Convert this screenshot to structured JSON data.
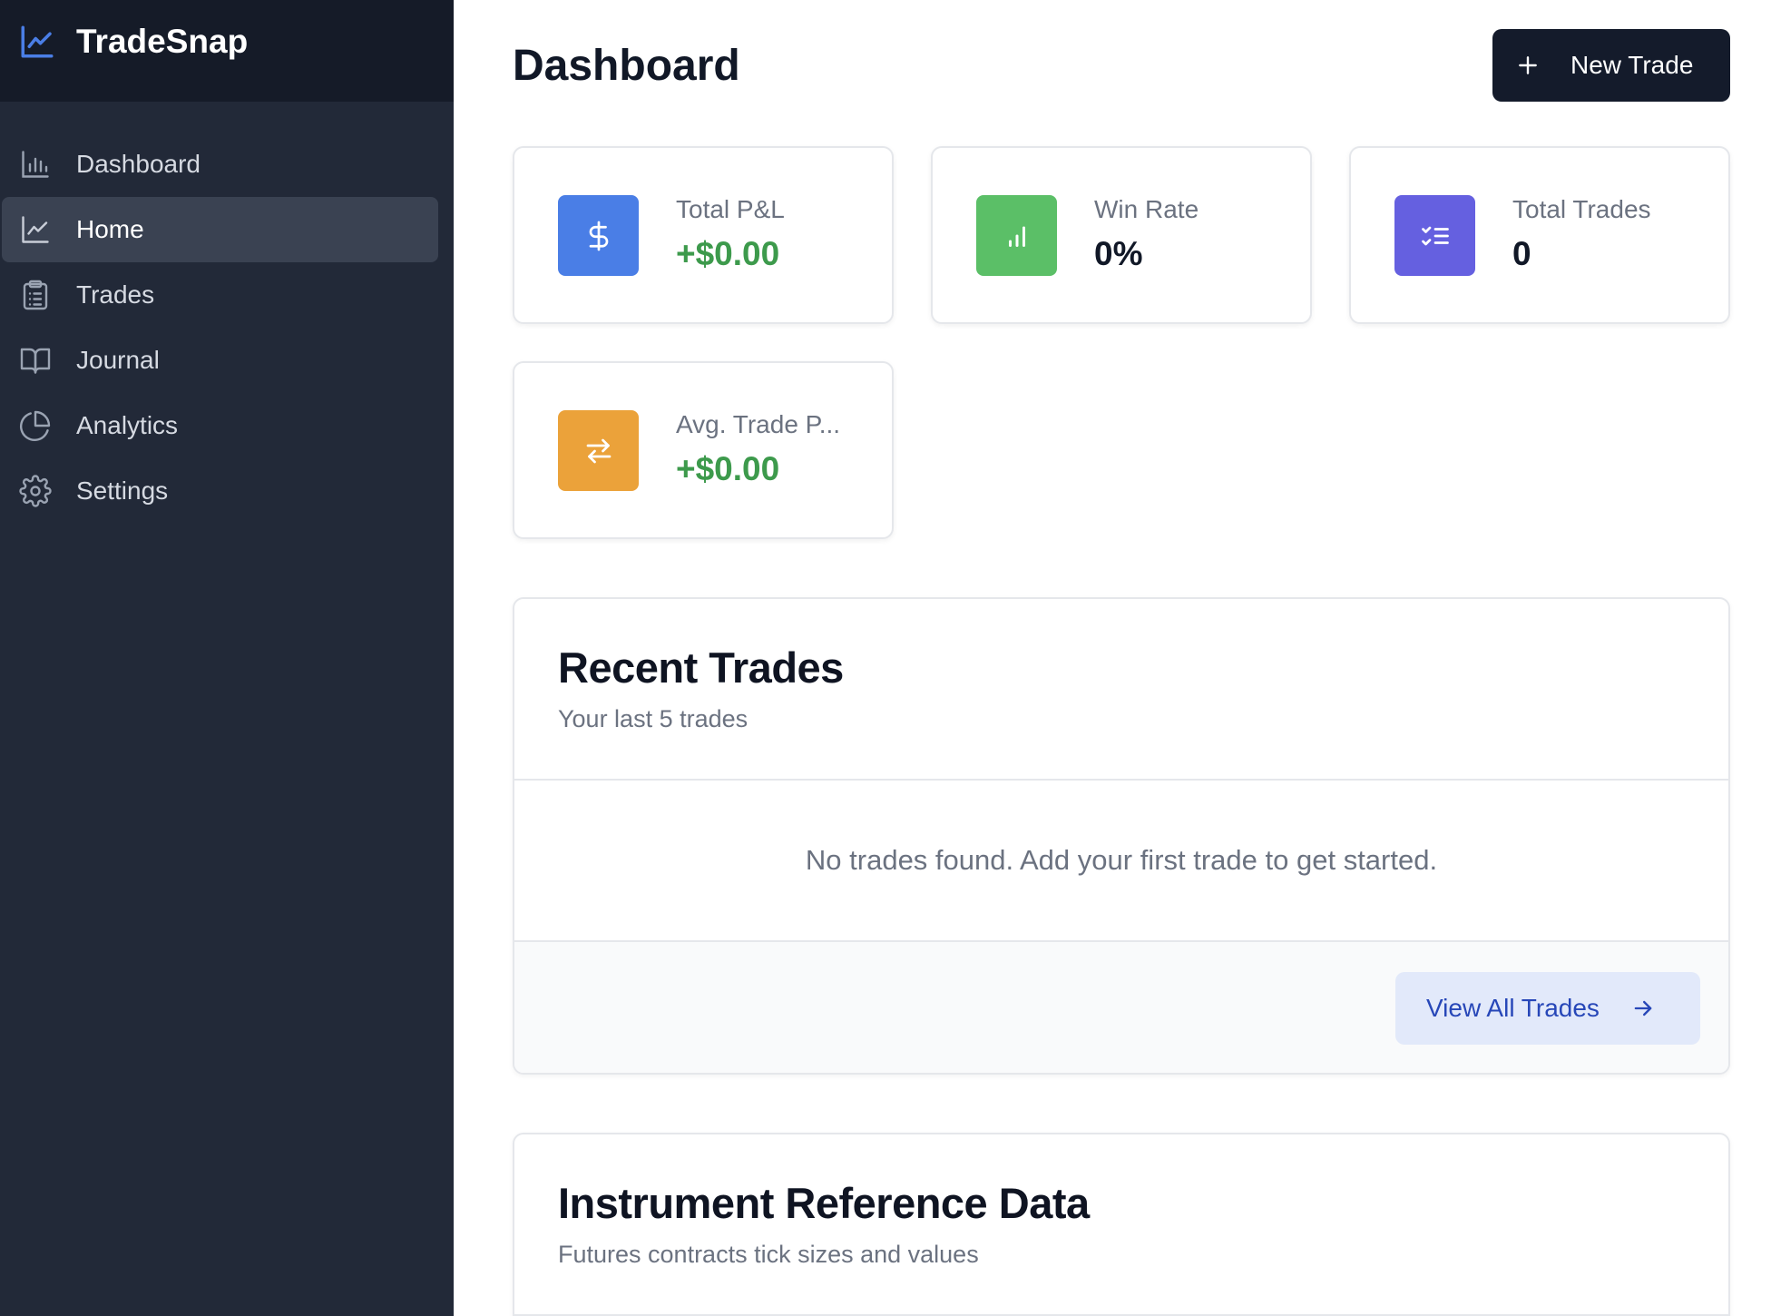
{
  "app": {
    "name": "TradeSnap",
    "logo_icon": "line-chart-icon"
  },
  "sidebar": {
    "items": [
      {
        "label": "Dashboard",
        "icon": "bar-chart-icon",
        "active": false
      },
      {
        "label": "Home",
        "icon": "line-chart-icon",
        "active": true
      },
      {
        "label": "Trades",
        "icon": "clipboard-list-icon",
        "active": false
      },
      {
        "label": "Journal",
        "icon": "book-open-icon",
        "active": false
      },
      {
        "label": "Analytics",
        "icon": "pie-chart-icon",
        "active": false
      },
      {
        "label": "Settings",
        "icon": "gear-icon",
        "active": false
      }
    ]
  },
  "header": {
    "title": "Dashboard",
    "new_trade_label": "New Trade",
    "new_trade_icon": "plus-icon"
  },
  "stats": [
    {
      "label": "Total P&L",
      "value": "+$0.00",
      "icon": "dollar-icon",
      "color": "#4a7ee6",
      "positive": true
    },
    {
      "label": "Win Rate",
      "value": "0%",
      "icon": "signal-bars-icon",
      "color": "#5bbf67",
      "positive": false
    },
    {
      "label": "Total Trades",
      "value": "0",
      "icon": "checklist-icon",
      "color": "#6560e0",
      "positive": false
    },
    {
      "label": "Avg. Trade P...",
      "value": "+$0.00",
      "icon": "swap-arrows-icon",
      "color": "#eba23a",
      "positive": true
    }
  ],
  "recent_trades": {
    "title": "Recent Trades",
    "subtitle": "Your last 5 trades",
    "empty_message": "No trades found. Add your first trade to get started.",
    "view_all_label": "View All Trades",
    "view_all_icon": "arrow-right-icon"
  },
  "instrument_reference": {
    "title": "Instrument Reference Data",
    "subtitle": "Futures contracts tick sizes and values"
  },
  "colors": {
    "sidebar_bg": "#222938",
    "brand_bg": "#151b28",
    "accent_blue": "#4a7ee6",
    "positive_green": "#3d9a4c",
    "primary_button": "#141b2b"
  }
}
